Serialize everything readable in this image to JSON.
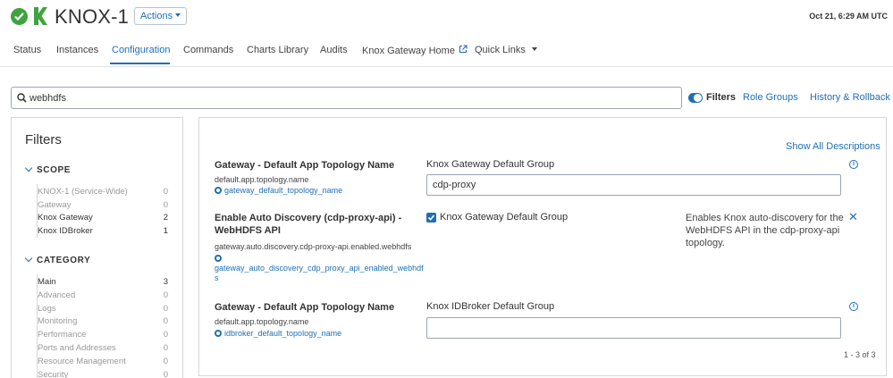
{
  "header": {
    "service_name": "KNOX-1",
    "actions_label": "Actions",
    "timestamp": "Oct 21, 6:29 AM UTC"
  },
  "tabs": [
    {
      "label": "Status"
    },
    {
      "label": "Instances"
    },
    {
      "label": "Configuration"
    },
    {
      "label": "Commands"
    },
    {
      "label": "Charts Library"
    },
    {
      "label": "Audits"
    },
    {
      "label": "Knox Gateway Home"
    },
    {
      "label": "Quick Links"
    }
  ],
  "active_tab": "Configuration",
  "search": {
    "value": "webhdfs"
  },
  "toolbar": {
    "filters_label": "Filters",
    "role_groups": "Role Groups",
    "history": "History & Rollback"
  },
  "filters": {
    "title": "Filters",
    "scope": {
      "heading": "SCOPE",
      "items": [
        {
          "label": "KNOX-1 (Service-Wide)",
          "count": "0"
        },
        {
          "label": "Gateway",
          "count": "0"
        },
        {
          "label": "Knox Gateway",
          "count": "2"
        },
        {
          "label": "Knox IDBroker",
          "count": "1"
        }
      ]
    },
    "category": {
      "heading": "CATEGORY",
      "items": [
        {
          "label": "Main",
          "count": "3"
        },
        {
          "label": "Advanced",
          "count": "0"
        },
        {
          "label": "Logs",
          "count": "0"
        },
        {
          "label": "Monitoring",
          "count": "0"
        },
        {
          "label": "Performance",
          "count": "0"
        },
        {
          "label": "Ports and Addresses",
          "count": "0"
        },
        {
          "label": "Resource Management",
          "count": "0"
        },
        {
          "label": "Security",
          "count": "0"
        }
      ]
    }
  },
  "main": {
    "show_all": "Show All Descriptions",
    "rows": [
      {
        "title": "Gateway - Default App Topology Name",
        "key": "default.app.topology.name",
        "link": "gateway_default_topology_name",
        "group": "Knox Gateway Default Group",
        "value": "cdp-proxy"
      },
      {
        "title_line1": "Enable Auto Discovery (cdp-proxy-api) -",
        "title_line2": "WebHDFS API",
        "key": "gateway.auto.discovery.cdp-proxy-api.enabled.webhdfs",
        "link_line1": "gateway_auto_discovery_cdp_proxy_api_enabled_webhdf",
        "link_line2": "s",
        "group": "Knox Gateway Default Group",
        "checked": true,
        "description": "Enables Knox auto-discovery for the WebHDFS API in the cdp-proxy-api topology."
      },
      {
        "title": "Gateway - Default App Topology Name",
        "key": "default.app.topology.name",
        "link": "idbroker_default_topology_name",
        "group": "Knox IDBroker Default Group",
        "value": ""
      }
    ],
    "pager": "1 - 3 of 3"
  },
  "colors": {
    "accent": "#1f6fb5",
    "status_ok": "#3fa33f",
    "logo": "#3fa33f"
  }
}
